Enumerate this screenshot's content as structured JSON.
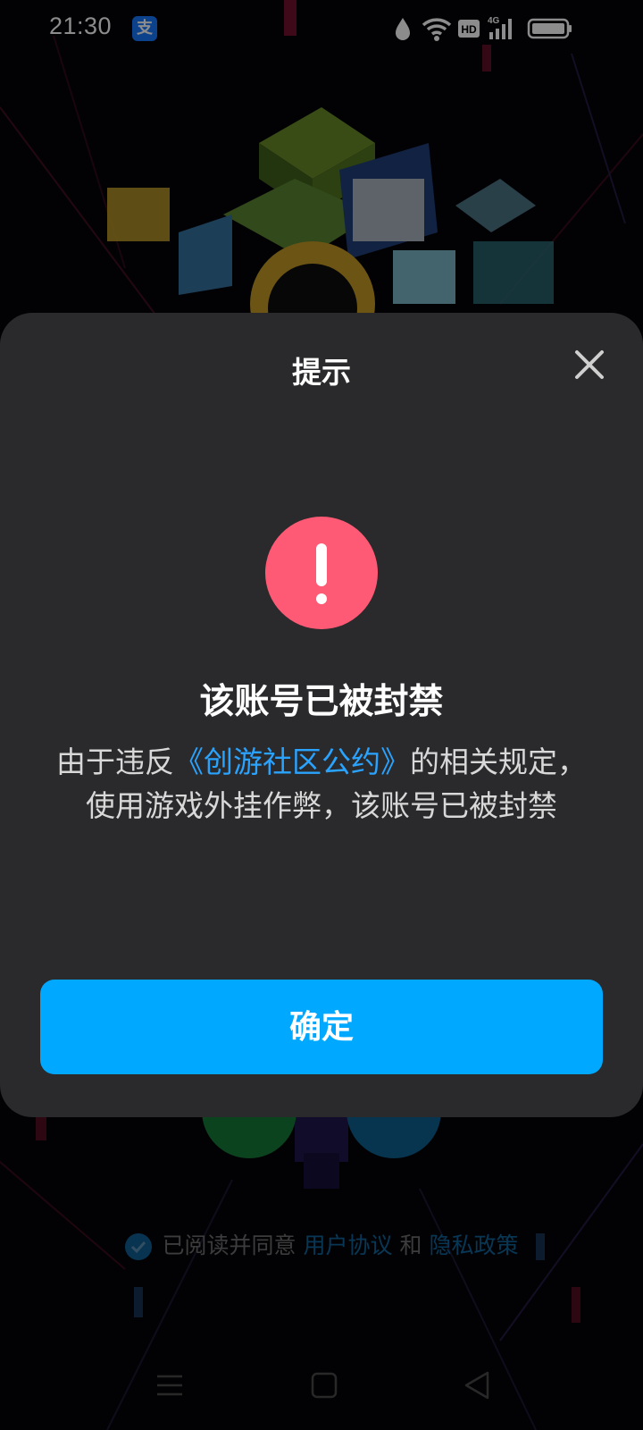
{
  "status_bar": {
    "time": "21:30",
    "app_icon": "alipay-icon",
    "app_glyph": "支",
    "network_label": "4G",
    "hd_label": "HD",
    "icons": [
      "water-drop-icon",
      "wifi-icon",
      "hd-icon",
      "signal-icon",
      "battery-icon"
    ]
  },
  "dialog": {
    "title": "提示",
    "close_icon": "close-icon",
    "alert_icon": "exclamation-icon",
    "heading": "该账号已被封禁",
    "message_prefix": "由于违反",
    "message_link": "《创游社区公约》",
    "message_suffix": "的相关规定，使用游戏外挂作弊，该账号已被封禁",
    "confirm_label": "确定"
  },
  "agreement": {
    "checked": true,
    "text_prefix": "已阅读并同意",
    "user_agreement": "用户协议",
    "and_text": "和",
    "privacy_policy": "隐私政策"
  },
  "nav": {
    "icons": [
      "menu-icon",
      "home-icon",
      "back-icon"
    ]
  },
  "colors": {
    "dialog_bg": "#2a2a2c",
    "accent": "#00a8ff",
    "link": "#2aa3ff",
    "alert": "#ff5a75"
  }
}
